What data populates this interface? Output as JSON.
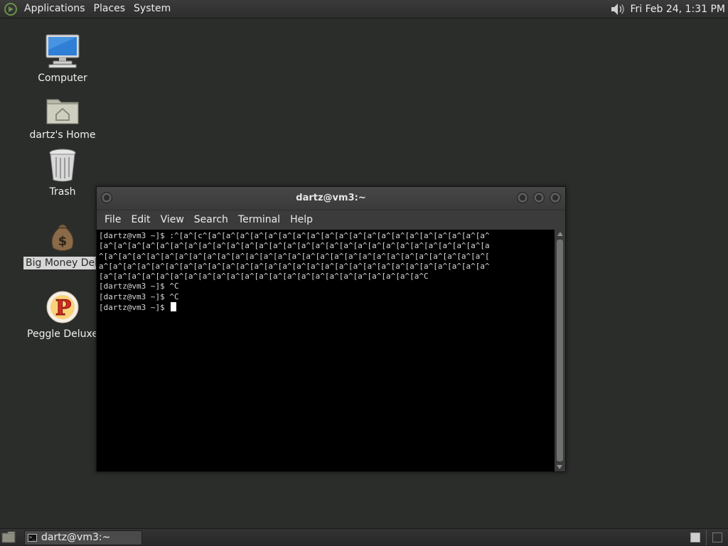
{
  "top_panel": {
    "menus": [
      "Applications",
      "Places",
      "System"
    ],
    "clock": "Fri Feb 24,  1:31 PM",
    "icons": {
      "distro": "distro-logo-icon",
      "volume": "speaker-volume-icon"
    }
  },
  "desktop": {
    "icons": [
      {
        "label": "Computer",
        "icon": "computer-monitor-icon"
      },
      {
        "label": "dartz's Home",
        "icon": "home-folder-icon"
      },
      {
        "label": "Trash",
        "icon": "trash-can-icon"
      },
      {
        "label": "Big Money Delux",
        "icon": "money-bag-icon"
      },
      {
        "label": "Peggle Deluxe",
        "icon": "peggle-logo-icon"
      }
    ]
  },
  "terminal": {
    "title": "dartz@vm3:~",
    "menu": [
      "File",
      "Edit",
      "View",
      "Search",
      "Terminal",
      "Help"
    ],
    "lines": [
      "[dartz@vm3 ~]$ :^[a^[c^[a^[a^[a^[a^[a^[a^[a^[a^[a^[a^[a^[a^[a^[a^[a^[a^[a^[a^[a^[a^",
      "[a^[a^[a^[a^[a^[a^[a^[a^[a^[a^[a^[a^[a^[a^[a^[a^[a^[a^[a^[a^[a^[a^[a^[a^[a^[a^[a^[a",
      "^[a^[a^[a^[a^[a^[a^[a^[a^[a^[a^[a^[a^[a^[a^[a^[a^[a^[a^[a^[a^[a^[a^[a^[a^[a^[a^[a^[",
      "a^[a^[a^[a^[a^[a^[a^[a^[a^[a^[a^[a^[a^[a^[a^[a^[a^[a^[a^[a^[a^[a^[a^[a^[a^[a^[a^[a^",
      "[a^[a^[a^[a^[a^[a^[a^[a^[a^[a^[a^[a^[a^[a^[a^[a^[a^[a^[a^[a^[a^[a^[a^C",
      "[dartz@vm3 ~]$ ^C",
      "[dartz@vm3 ~]$ ^C"
    ],
    "prompt": "[dartz@vm3 ~]$ "
  },
  "bottom_panel": {
    "task_label": "dartz@vm3:~",
    "icons": {
      "show_desktop": "show-desktop-icon",
      "task": "terminal-icon"
    },
    "workspaces": 2,
    "active_workspace": 1
  }
}
